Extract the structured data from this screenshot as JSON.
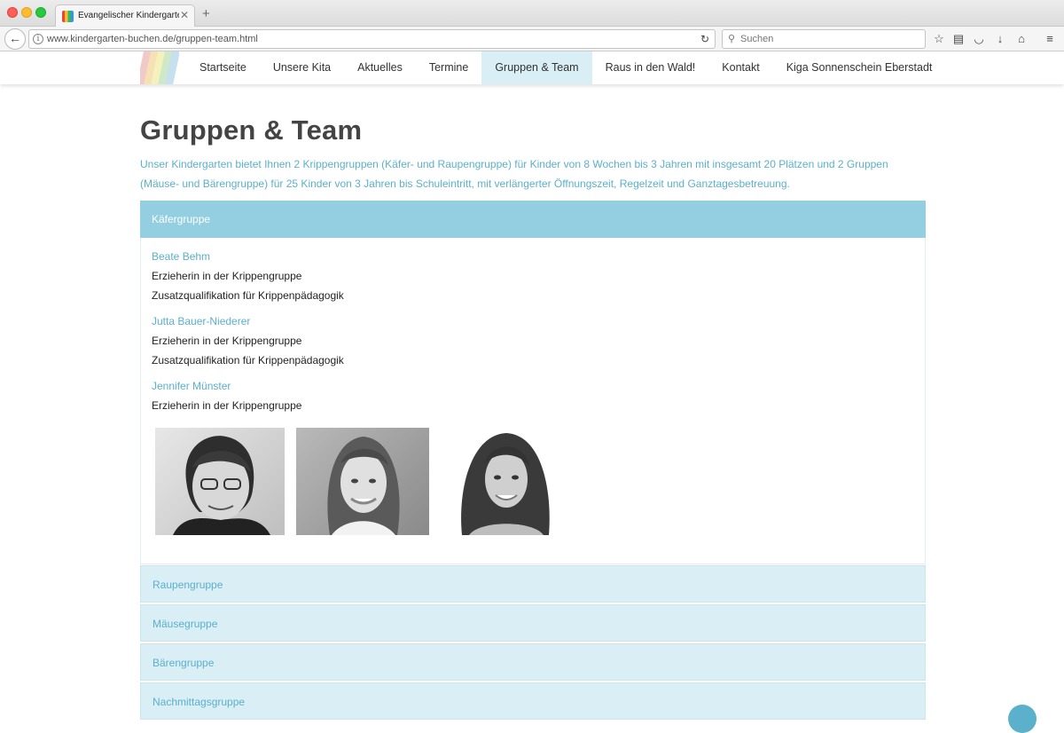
{
  "browser": {
    "tab_title": "Evangelischer Kindergarten R",
    "url": "www.kindergarten-buchen.de/gruppen-team.html",
    "search_placeholder": "Suchen"
  },
  "nav": {
    "items": [
      {
        "label": "Startseite"
      },
      {
        "label": "Unsere Kita"
      },
      {
        "label": "Aktuelles"
      },
      {
        "label": "Termine"
      },
      {
        "label": "Gruppen & Team",
        "active": true
      },
      {
        "label": "Raus in den Wald!"
      },
      {
        "label": "Kontakt"
      },
      {
        "label": "Kiga Sonnenschein Eberstadt"
      }
    ]
  },
  "page": {
    "title": "Gruppen & Team",
    "intro": "Unser Kindergarten bietet Ihnen 2 Krippengruppen (Käfer- und Raupengruppe) für Kinder von 8 Wochen bis 3 Jahren mit insgesamt 20 Plätzen und 2 Gruppen (Mäuse- und Bärengruppe) für 25 Kinder von 3 Jahren bis Schuleintritt, mit verlängerter Öffnungszeit, Regelzeit und Ganztagesbetreuung."
  },
  "accordion": {
    "open_group": {
      "title": "Käfergruppe",
      "members": [
        {
          "name": "Beate Behm",
          "lines": [
            "Erzieherin in der Krippengruppe",
            "Zusatzqualifikation für Krippenpädagogik"
          ]
        },
        {
          "name": "Jutta Bauer-Niederer",
          "lines": [
            "Erzieherin in der Krippengruppe",
            "Zusatzqualifikation für Krippenpädagogik"
          ]
        },
        {
          "name": "Jennifer Münster",
          "lines": [
            "Erzieherin in der Krippengruppe"
          ]
        }
      ]
    },
    "collapsed_groups": [
      "Raupengruppe",
      "Mäusegruppe",
      "Bärengruppe",
      "Nachmittagsgruppe"
    ]
  },
  "colors": {
    "accent": "#5bb0cc",
    "accordion_open": "#93cfe1",
    "accordion_closed": "#daeef5",
    "nav_active": "#d9eef5"
  }
}
